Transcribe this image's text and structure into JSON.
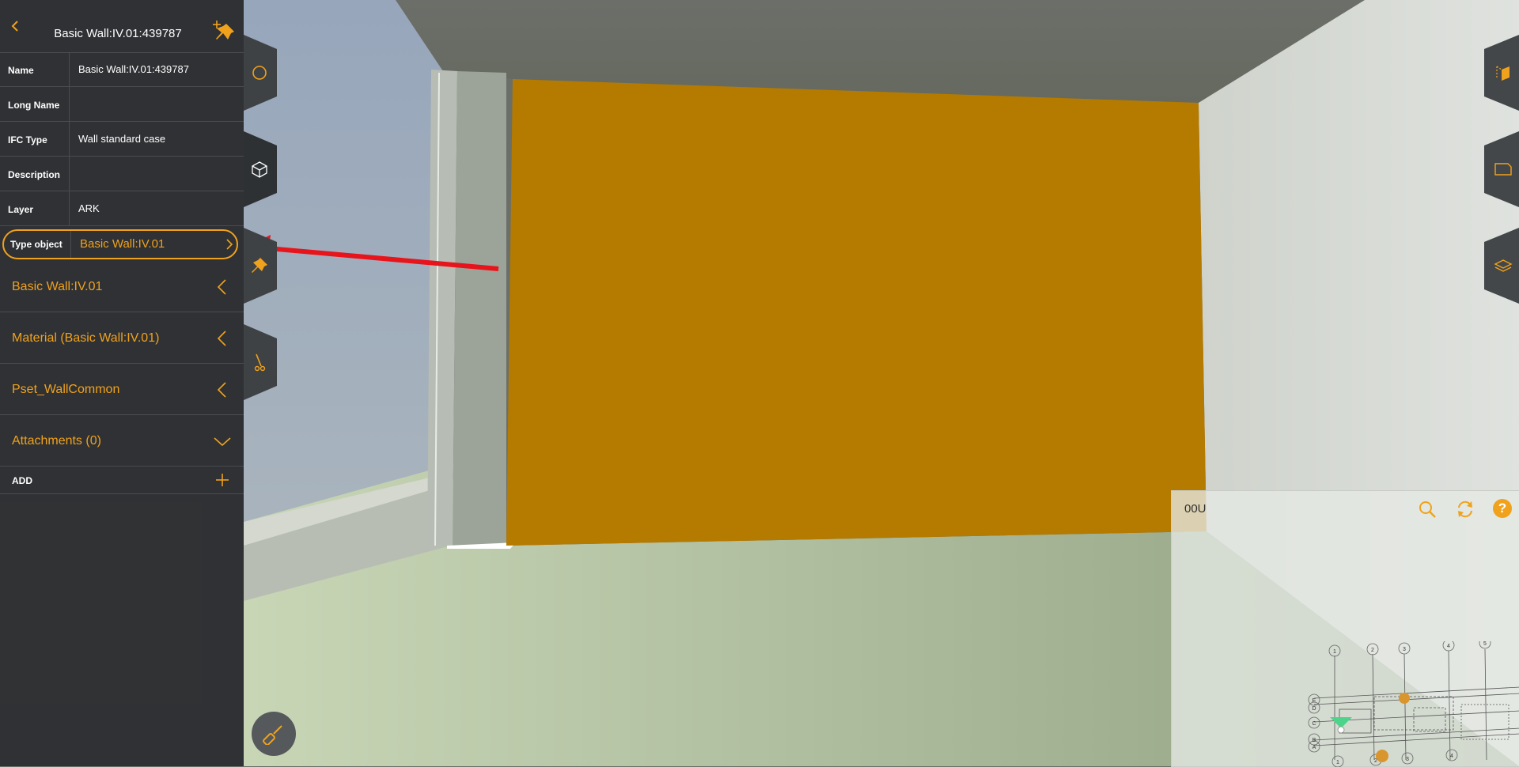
{
  "panel": {
    "title": "Basic Wall:IV.01:439787",
    "properties": [
      {
        "label": "Name",
        "value": "Basic Wall:IV.01:439787"
      },
      {
        "label": "Long Name",
        "value": ""
      },
      {
        "label": "IFC Type",
        "value": "Wall standard case"
      },
      {
        "label": "Description",
        "value": ""
      },
      {
        "label": "Layer",
        "value": "ARK"
      }
    ],
    "type_object": {
      "label": "Type object",
      "value": "Basic Wall:IV.01"
    },
    "sections": [
      {
        "label": "Basic Wall:IV.01",
        "state": "collapsed-left"
      },
      {
        "label": "Material (Basic Wall:IV.01)",
        "state": "collapsed-left"
      },
      {
        "label": "Pset_WallCommon",
        "state": "collapsed-left"
      },
      {
        "label": "Attachments (0)",
        "state": "expand-down"
      }
    ],
    "add_label": "ADD"
  },
  "tools_left": [
    "circle-select-icon",
    "cube-icon",
    "pin-icon",
    "section-cut-icon"
  ],
  "tools_right": [
    "view-cube-icon",
    "sheet-icon",
    "layers-icon"
  ],
  "minimap": {
    "level": "00U",
    "buttons": [
      "search-icon",
      "refresh-icon",
      "help-icon"
    ],
    "help_glyph": "?",
    "grid_top": [
      "1",
      "2",
      "3",
      "4",
      "5"
    ],
    "grid_left": [
      "E",
      "D",
      "C",
      "B",
      "A"
    ],
    "grid_bottom": [
      "1",
      "2",
      "3",
      "4"
    ]
  },
  "colors": {
    "accent": "#f0a21c",
    "wall": "#b57a00",
    "panel": "#2c2e31",
    "arrow": "#e8141b"
  }
}
